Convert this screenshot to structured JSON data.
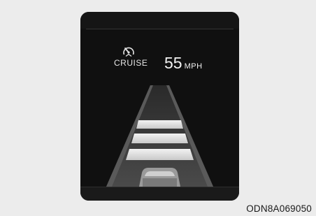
{
  "cruise": {
    "label": "CRUISE",
    "icon": "cruise-control-icon"
  },
  "speed": {
    "value": "55",
    "unit": "MPH"
  },
  "figure_code": "ODN8A069050",
  "colors": {
    "background": "#ececec",
    "cluster": "#101010",
    "road": "#3a3a3a",
    "distance_bar": "#dedede"
  }
}
